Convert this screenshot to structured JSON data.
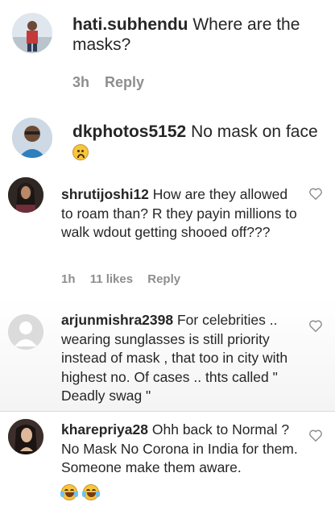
{
  "comments": [
    {
      "username": "hati.subhendu",
      "text": "Where are the masks?",
      "time": "3h",
      "reply_label": "Reply"
    },
    {
      "username": "dkphotos5152",
      "text": "No mask on face",
      "emoji": "sad-face"
    },
    {
      "username": "shrutijoshi12",
      "text": "How are they allowed to roam than? R they payin millions to walk wdout getting shooed off???",
      "time": "1h",
      "likes": "11 likes",
      "reply_label": "Reply"
    },
    {
      "username": "arjunmishra2398",
      "text": "For celebrities .. wearing sunglasses is still priority instead of mask , that too in city with highest no. Of cases .. thts called \" Deadly swag \""
    },
    {
      "username": "kharepriya28",
      "text": "Ohh back to Normal ? No Mask No Corona in India for them. Someone make them aware.",
      "emoji": "tears-of-joy x2"
    }
  ],
  "colors": {
    "text": "#262626",
    "meta": "#8e8e8e",
    "divider": "#dbdbdb"
  }
}
